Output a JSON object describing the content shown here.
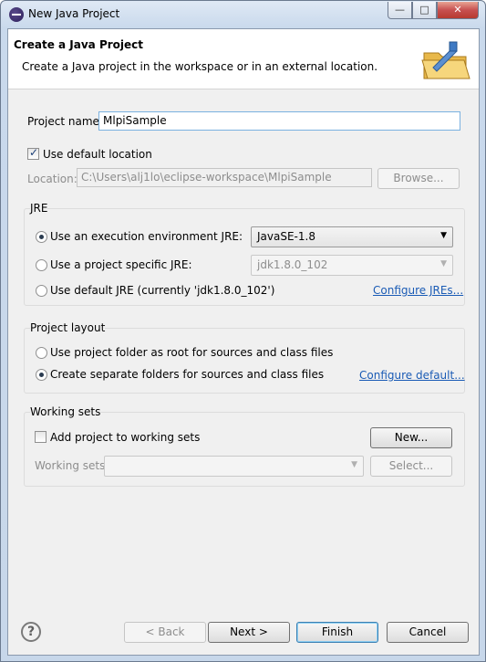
{
  "window": {
    "title": "New Java Project"
  },
  "titlebar_buttons": {
    "minimize": "—",
    "maximize": "□",
    "close": "✕"
  },
  "header": {
    "title": "Create a Java Project",
    "description": "Create a Java project in the workspace or in an external location.",
    "icon": "folder-wizard-icon"
  },
  "project": {
    "name_label": "Project name:",
    "name_value": "MlpiSample",
    "use_default_location_label": "Use default location",
    "use_default_location_checked": true,
    "location_label": "Location:",
    "location_value": "C:\\Users\\alj1lo\\eclipse-workspace\\MlpiSample",
    "browse_label": "Browse..."
  },
  "jre": {
    "group_title": "JRE",
    "exec_env_label": "Use an execution environment JRE:",
    "exec_env_value": "JavaSE-1.8",
    "specific_label": "Use a project specific JRE:",
    "specific_value": "jdk1.8.0_102",
    "default_label": "Use default JRE (currently 'jdk1.8.0_102')",
    "configure_link": "Configure JREs...",
    "selected": "exec_env"
  },
  "layout": {
    "group_title": "Project layout",
    "root_label": "Use project folder as root for sources and class files",
    "separate_label": "Create separate folders for sources and class files",
    "configure_link": "Configure default...",
    "selected": "separate"
  },
  "working_sets": {
    "group_title": "Working sets",
    "add_label": "Add project to working sets",
    "add_checked": false,
    "new_label": "New...",
    "sets_label": "Working sets:",
    "sets_value": "",
    "select_label": "Select..."
  },
  "footer": {
    "help": "?",
    "back_label": "< Back",
    "next_label": "Next >",
    "finish_label": "Finish",
    "cancel_label": "Cancel"
  },
  "colors": {
    "link": "#1a5bb5",
    "disabled_text": "#8d8d8d",
    "focus_border": "#7ab1e0"
  }
}
